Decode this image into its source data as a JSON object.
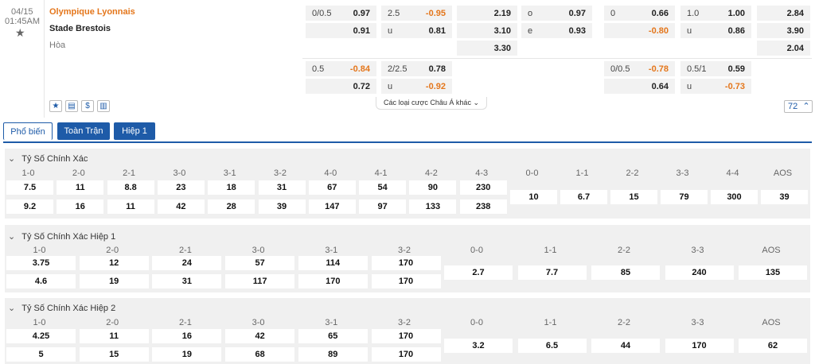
{
  "match": {
    "date": "04/15",
    "time": "01:45AM",
    "home": "Olympique Lyonnais",
    "away": "Stade Brestois",
    "draw": "Hòa"
  },
  "colors": {
    "accent": "#1e5ba8",
    "home_team": "#e4761b",
    "negative": "#e4761b"
  },
  "odds": {
    "ft_hdp": [
      {
        "line": "0/0.5",
        "home": "0.97",
        "away": "0.91"
      },
      {
        "line": "0.5",
        "home": "-0.84",
        "away": "0.72"
      }
    ],
    "ft_ou": [
      {
        "line": "2.5",
        "over": "-0.95",
        "under_label": "u",
        "under": "0.81"
      },
      {
        "line": "2/2.5",
        "over": "0.78",
        "under_label": "u",
        "under": "-0.92"
      }
    ],
    "ft_1x2": [
      "2.19",
      "3.10",
      "3.30"
    ],
    "ft_oe": [
      {
        "label": "o",
        "value": "0.97"
      },
      {
        "label": "e",
        "value": "0.93"
      }
    ],
    "h1_hdp": [
      {
        "line": "0",
        "home": "0.66",
        "away": "-0.80"
      },
      {
        "line": "0/0.5",
        "home": "-0.78",
        "away": "0.64"
      }
    ],
    "h1_ou": [
      {
        "line": "1.0",
        "over": "1.00",
        "under_label": "u",
        "under": "0.86"
      },
      {
        "line": "0.5/1",
        "over": "0.59",
        "under_label": "u",
        "under": "-0.73"
      }
    ],
    "h1_1x2": [
      "2.84",
      "3.90",
      "2.04"
    ],
    "more_markets": "Các loại cược Châu Á khác",
    "more_count": "72"
  },
  "toolbar": {
    "icons": [
      "star-icon",
      "print-icon",
      "dollar-icon",
      "chart-icon"
    ]
  },
  "tabs": [
    {
      "label": "Phổ biến",
      "active": true
    },
    {
      "label": "Toàn Trận",
      "active": false
    },
    {
      "label": "Hiệp 1",
      "active": false
    }
  ],
  "sections": [
    {
      "title": "Tỷ Số Chính Xác",
      "left_labels": [
        "1-0",
        "2-0",
        "2-1",
        "3-0",
        "3-1",
        "3-2",
        "4-0",
        "4-1",
        "4-2",
        "4-3"
      ],
      "left_row1": [
        "7.5",
        "11",
        "8.8",
        "23",
        "18",
        "31",
        "67",
        "54",
        "90",
        "230"
      ],
      "left_row2": [
        "9.2",
        "16",
        "11",
        "42",
        "28",
        "39",
        "147",
        "97",
        "133",
        "238"
      ],
      "right_labels": [
        "0-0",
        "1-1",
        "2-2",
        "3-3",
        "4-4",
        "AOS"
      ],
      "right_values": [
        "10",
        "6.7",
        "15",
        "79",
        "300",
        "39"
      ]
    },
    {
      "title": "Tỷ Số Chính Xác Hiệp 1",
      "left_labels": [
        "1-0",
        "2-0",
        "2-1",
        "3-0",
        "3-1",
        "3-2"
      ],
      "left_row1": [
        "3.75",
        "12",
        "24",
        "57",
        "114",
        "170"
      ],
      "left_row2": [
        "4.6",
        "19",
        "31",
        "117",
        "170",
        "170"
      ],
      "right_labels": [
        "0-0",
        "1-1",
        "2-2",
        "3-3",
        "AOS"
      ],
      "right_values": [
        "2.7",
        "7.7",
        "85",
        "240",
        "135"
      ]
    },
    {
      "title": "Tỷ Số Chính Xác Hiệp 2",
      "left_labels": [
        "1-0",
        "2-0",
        "2-1",
        "3-0",
        "3-1",
        "3-2"
      ],
      "left_row1": [
        "4.25",
        "11",
        "16",
        "42",
        "65",
        "170"
      ],
      "left_row2": [
        "5",
        "15",
        "19",
        "68",
        "89",
        "170"
      ],
      "right_labels": [
        "0-0",
        "1-1",
        "2-2",
        "3-3",
        "AOS"
      ],
      "right_values": [
        "3.2",
        "6.5",
        "44",
        "170",
        "62"
      ]
    }
  ]
}
